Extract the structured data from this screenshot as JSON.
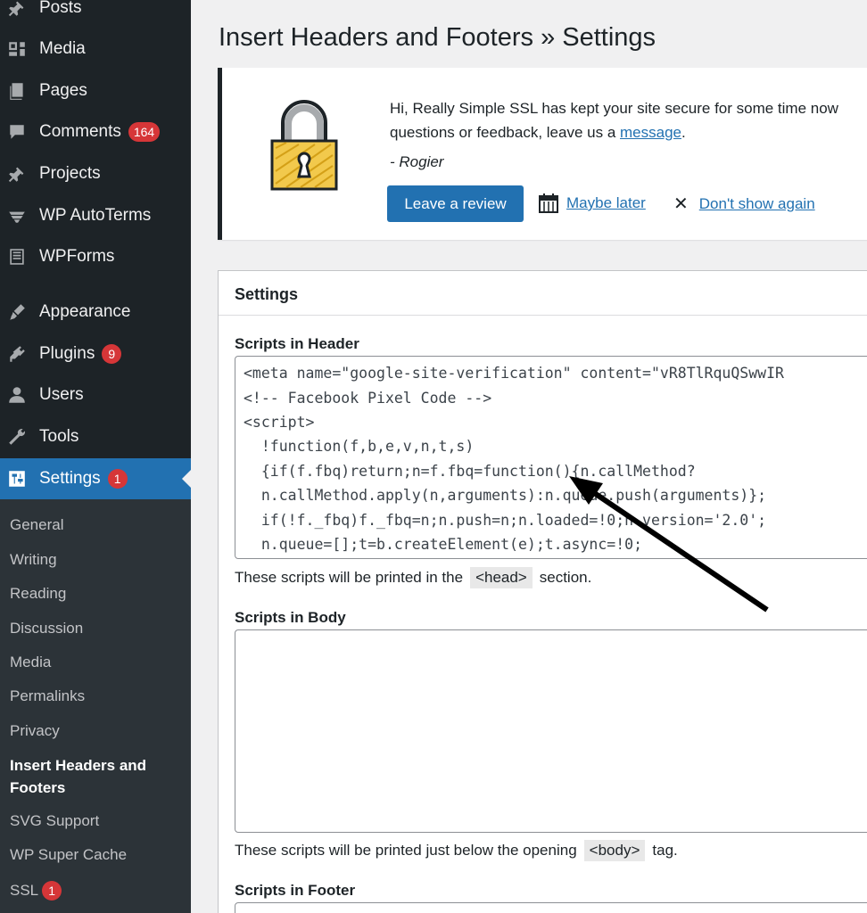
{
  "sidebar": {
    "items": [
      {
        "label": "Posts",
        "icon": "pin-icon"
      },
      {
        "label": "Media",
        "icon": "media-icon"
      },
      {
        "label": "Pages",
        "icon": "pages-icon"
      },
      {
        "label": "Comments",
        "icon": "comment-icon",
        "badge": "164"
      },
      {
        "label": "Projects",
        "icon": "pin-icon"
      },
      {
        "label": "WP AutoTerms",
        "icon": "autoterms-icon"
      },
      {
        "label": "WPForms",
        "icon": "wpforms-icon"
      },
      {
        "label": "Appearance",
        "icon": "brush-icon"
      },
      {
        "label": "Plugins",
        "icon": "plugin-icon",
        "badge": "9"
      },
      {
        "label": "Users",
        "icon": "user-icon"
      },
      {
        "label": "Tools",
        "icon": "wrench-icon"
      },
      {
        "label": "Settings",
        "icon": "settings-icon",
        "badge": "1"
      }
    ],
    "submenu": [
      "General",
      "Writing",
      "Reading",
      "Discussion",
      "Media",
      "Permalinks",
      "Privacy",
      "Insert Headers and",
      "Footers",
      "SVG Support",
      "WP Super Cache",
      "SSL"
    ],
    "ssl_badge": "1"
  },
  "page": {
    "title": "Insert Headers and Footers » Settings"
  },
  "notice": {
    "line1": "Hi, Really Simple SSL has kept your site secure for some time now",
    "line2_prefix": "questions or feedback, leave us a ",
    "line2_link": "message",
    "line2_suffix": ".",
    "signature": "- Rogier",
    "review_button": "Leave a review",
    "maybe_later": "Maybe later",
    "dont_show": "Don't show again"
  },
  "settings": {
    "title": "Settings",
    "header_label": "Scripts in Header",
    "header_code": [
      "<meta name=\"google-site-verification\" content=\"vR8TlRquQSwwIR",
      "<!-- Facebook Pixel Code -->",
      "<script>",
      "  !function(f,b,e,v,n,t,s)",
      "  {if(f.fbq)return;n=f.fbq=function(){n.callMethod?",
      "  n.callMethod.apply(n,arguments):n.queue.push(arguments)};",
      "  if(!f._fbq)f._fbq=n;n.push=n;n.loaded=!0;n.version='2.0';",
      "  n.queue=[];t=b.createElement(e);t.async=!0;"
    ],
    "header_help_prefix": "These scripts will be printed in the",
    "header_help_code": "<head>",
    "header_help_suffix": "section.",
    "body_label": "Scripts in Body",
    "body_help_prefix": "These scripts will be printed just below the opening",
    "body_help_code": "<body>",
    "body_help_suffix": "tag.",
    "footer_label": "Scripts in Footer"
  },
  "colors": {
    "sidebar_bg": "#1d2327",
    "active_bg": "#2271b1",
    "badge": "#d63638",
    "link": "#2271b1"
  }
}
